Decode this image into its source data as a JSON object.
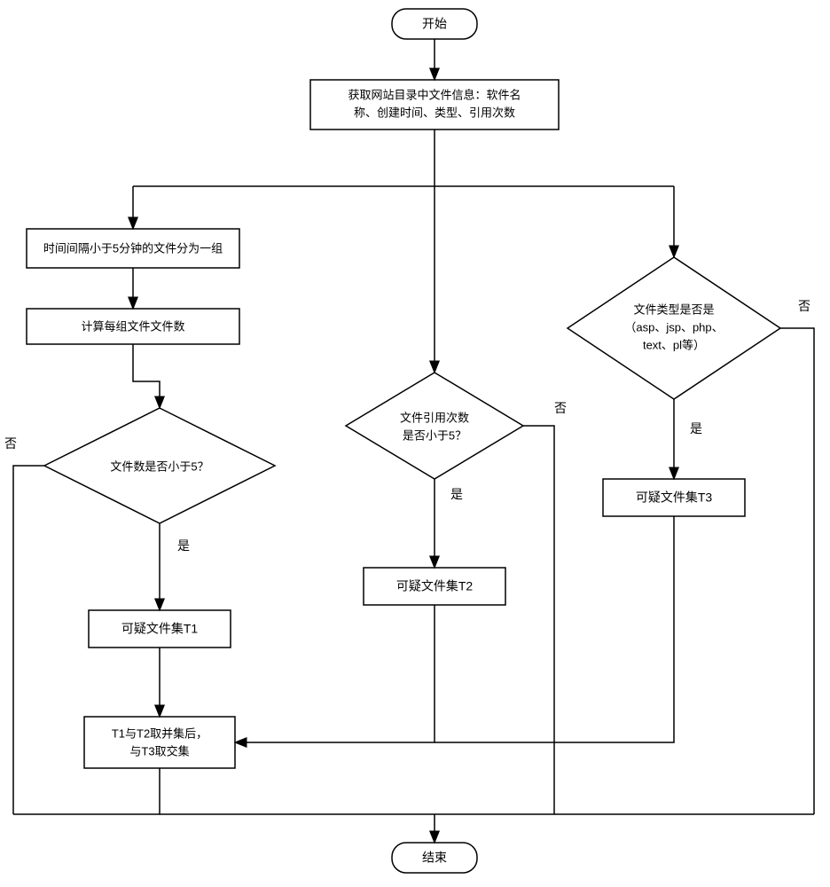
{
  "flowchart": {
    "start": "开始",
    "end": "结束",
    "fetch_info_l1": "获取网站目录中文件信息：软件名",
    "fetch_info_l2": "称、创建时间、类型、引用次数",
    "group_files": "时间间隔小于5分钟的文件分为一组",
    "count_files": "计算每组文件文件数",
    "decision_count": "文件数是否小于5？",
    "decision_refs_l1": "文件引用次数",
    "decision_refs_l2": "是否小于5？",
    "decision_type_l1": "文件类型是否是",
    "decision_type_l2": "（asp、jsp、php、",
    "decision_type_l3": "text、pl等）",
    "set_t1": "可疑文件集T1",
    "set_t2": "可疑文件集T2",
    "set_t3": "可疑文件集T3",
    "combine_l1": "T1与T2取并集后，",
    "combine_l2": "与T3取交集",
    "yes": "是",
    "no": "否"
  },
  "chart_data": {
    "type": "flowchart",
    "nodes": [
      {
        "id": "start",
        "type": "terminator",
        "label": "开始"
      },
      {
        "id": "fetch",
        "type": "process",
        "label": "获取网站目录中文件信息：软件名称、创建时间、类型、引用次数"
      },
      {
        "id": "group",
        "type": "process",
        "label": "时间间隔小于5分钟的文件分为一组"
      },
      {
        "id": "count",
        "type": "process",
        "label": "计算每组文件文件数"
      },
      {
        "id": "d_count",
        "type": "decision",
        "label": "文件数是否小于5？"
      },
      {
        "id": "t1",
        "type": "process",
        "label": "可疑文件集T1"
      },
      {
        "id": "d_refs",
        "type": "decision",
        "label": "文件引用次数是否小于5？"
      },
      {
        "id": "t2",
        "type": "process",
        "label": "可疑文件集T2"
      },
      {
        "id": "d_type",
        "type": "decision",
        "label": "文件类型是否是（asp、jsp、php、text、pl等）"
      },
      {
        "id": "t3",
        "type": "process",
        "label": "可疑文件集T3"
      },
      {
        "id": "combine",
        "type": "process",
        "label": "T1与T2取并集后，与T3取交集"
      },
      {
        "id": "end",
        "type": "terminator",
        "label": "结束"
      }
    ],
    "edges": [
      {
        "from": "start",
        "to": "fetch"
      },
      {
        "from": "fetch",
        "to": "group"
      },
      {
        "from": "fetch",
        "to": "d_refs"
      },
      {
        "from": "fetch",
        "to": "d_type"
      },
      {
        "from": "group",
        "to": "count"
      },
      {
        "from": "count",
        "to": "d_count"
      },
      {
        "from": "d_count",
        "to": "t1",
        "label": "是"
      },
      {
        "from": "d_count",
        "to": "end",
        "label": "否"
      },
      {
        "from": "t1",
        "to": "combine"
      },
      {
        "from": "d_refs",
        "to": "t2",
        "label": "是"
      },
      {
        "from": "d_refs",
        "to": "end",
        "label": "否"
      },
      {
        "from": "t2",
        "to": "combine"
      },
      {
        "from": "d_type",
        "to": "t3",
        "label": "是"
      },
      {
        "from": "d_type",
        "to": "end",
        "label": "否"
      },
      {
        "from": "t3",
        "to": "combine"
      },
      {
        "from": "combine",
        "to": "end"
      }
    ]
  }
}
